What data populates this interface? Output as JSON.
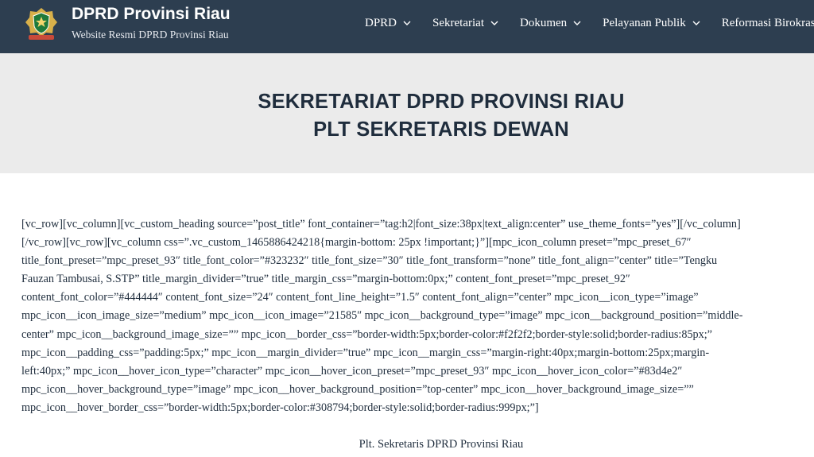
{
  "header": {
    "site_title": "DPRD Provinsi Riau",
    "tagline": "Website Resmi DPRD Provinsi Riau",
    "nav": [
      {
        "label": "DPRD"
      },
      {
        "label": "Sekretariat"
      },
      {
        "label": "Dokumen"
      },
      {
        "label": "Pelayanan Publik"
      },
      {
        "label": "Reformasi Birokrasi"
      }
    ]
  },
  "hero": {
    "title_line1": "SEKRETARIAT DPRD PROVINSI RIAU",
    "title_line2": "PLT SEKRETARIS DEWAN"
  },
  "content": {
    "shortcode_lines": [
      "[vc_row][vc_column][vc_custom_heading source=”post_title” font_container=”tag:h2|font_size:38px|text_align:center” use_theme_fonts=”yes”][/vc_column]",
      "[/vc_row][vc_row][vc_column css=”.vc_custom_1465886424218{margin-bottom: 25px !important;}”][mpc_icon_column preset=”mpc_preset_67″",
      "title_font_preset=”mpc_preset_93″ title_font_color=”#323232″ title_font_size=”30″ title_font_transform=”none” title_font_align=”center” title=”Tengku",
      "Fauzan Tambusai, S.STP” title_margin_divider=”true” title_margin_css=”margin-bottom:0px;” content_font_preset=”mpc_preset_92″",
      "content_font_color=”#444444″ content_font_size=”24″ content_font_line_height=”1.5″ content_font_align=”center” mpc_icon__icon_type=”image”",
      "mpc_icon__icon_image_size=”medium” mpc_icon__icon_image=”21585″ mpc_icon__background_type=”image” mpc_icon__background_position=”middle-",
      "center” mpc_icon__background_image_size=”” mpc_icon__border_css=”border-width:5px;border-color:#f2f2f2;border-style:solid;border-radius:85px;”",
      "mpc_icon__padding_css=”padding:5px;” mpc_icon__margin_divider=”true” mpc_icon__margin_css=”margin-right:40px;margin-bottom:25px;margin-",
      "left:40px;” mpc_icon__hover_icon_type=”character” mpc_icon__hover_icon_preset=”mpc_preset_93″ mpc_icon__hover_icon_color=”#83d4e2″",
      "mpc_icon__hover_background_type=”image” mpc_icon__hover_background_position=”top-center” mpc_icon__hover_background_image_size=””",
      "mpc_icon__hover_border_css=”border-width:5px;border-color:#308794;border-style:solid;border-radius:999px;”]"
    ],
    "caption": "Plt. Sekretaris DPRD Provinsi Riau"
  },
  "colors": {
    "header_bg": "#2d3e50",
    "hero_bg": "#ebebeb",
    "text": "#1f2d3d",
    "logo_gold": "#d8b04a",
    "logo_green": "#1f7a3a"
  },
  "icons": [
    "dprd-logo-icon",
    "chevron-down-icon"
  ]
}
